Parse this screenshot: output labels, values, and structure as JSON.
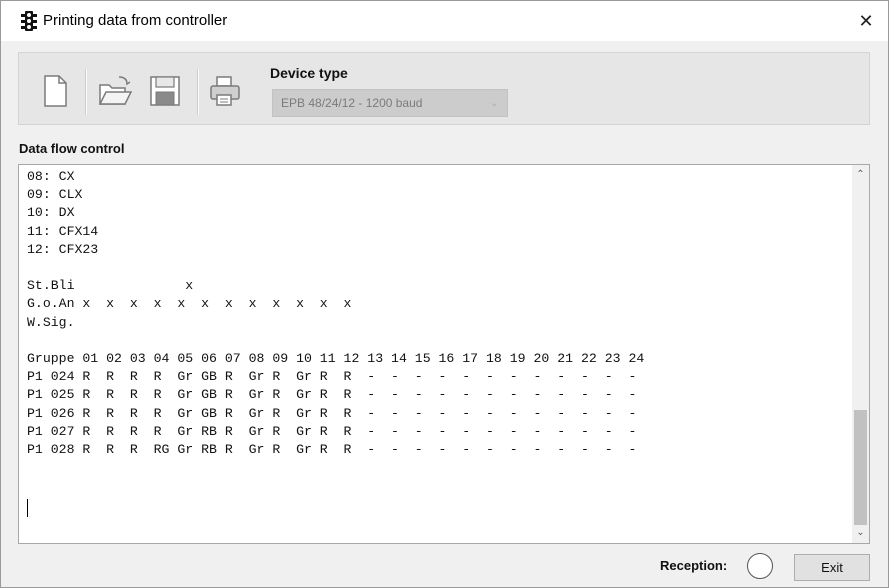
{
  "window": {
    "title": "Printing data from controller",
    "close_glyph": "✕"
  },
  "toolbar": {
    "buttons": [
      {
        "name": "new-document-icon"
      },
      {
        "name": "open-folder-icon"
      },
      {
        "name": "save-disk-icon"
      },
      {
        "name": "printer-icon"
      }
    ],
    "device_type_label": "Device type",
    "device_type_value": "EPB 48/24/12 - 1200 baud"
  },
  "data_flow": {
    "label": "Data flow control",
    "content": "08: CX\n09: CLX\n10: DX\n11: CFX14\n12: CFX23\n\nSt.Bli              x\nG.o.An x  x  x  x  x  x  x  x  x  x  x  x\nW.Sig.\n\nGruppe 01 02 03 04 05 06 07 08 09 10 11 12 13 14 15 16 17 18 19 20 21 22 23 24\nP1 024 R  R  R  R  Gr GB R  Gr R  Gr R  R  -  -  -  -  -  -  -  -  -  -  -  -\nP1 025 R  R  R  R  Gr GB R  Gr R  Gr R  R  -  -  -  -  -  -  -  -  -  -  -  -\nP1 026 R  R  R  R  Gr GB R  Gr R  Gr R  R  -  -  -  -  -  -  -  -  -  -  -  -\nP1 027 R  R  R  R  Gr RB R  Gr R  Gr R  R  -  -  -  -  -  -  -  -  -  -  -  -\nP1 028 R  R  R  RG Gr RB R  Gr R  Gr R  R  -  -  -  -  -  -  -  -  -  -  -  -"
  },
  "footer": {
    "reception_label": "Reception:",
    "exit_label": "Exit"
  }
}
